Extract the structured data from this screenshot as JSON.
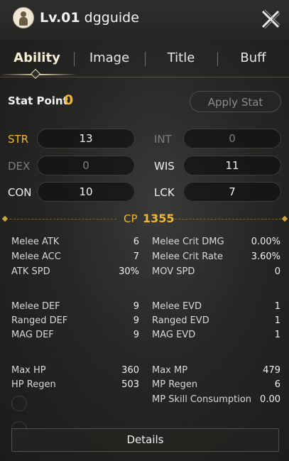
{
  "header": {
    "level": "Lv.01",
    "name": "dgguide"
  },
  "tabs": [
    {
      "label": "Ability",
      "active": true
    },
    {
      "label": "Image"
    },
    {
      "label": "Title"
    },
    {
      "label": "Buff"
    }
  ],
  "stat_point": {
    "label": "Stat Point",
    "value": "0",
    "apply_label": "Apply Stat"
  },
  "stats": {
    "str": {
      "label": "STR",
      "value": "13"
    },
    "int": {
      "label": "INT",
      "value": "0"
    },
    "dex": {
      "label": "DEX",
      "value": "0"
    },
    "wis": {
      "label": "WIS",
      "value": "11"
    },
    "con": {
      "label": "CON",
      "value": "10"
    },
    "lck": {
      "label": "LCK",
      "value": "7"
    }
  },
  "cp": {
    "label": "CP",
    "value": "1355"
  },
  "attributes": {
    "melee_atk": {
      "label": "Melee ATK",
      "value": "6"
    },
    "melee_crit_dmg": {
      "label": "Melee Crit DMG",
      "value": "0.00%"
    },
    "melee_acc": {
      "label": "Melee ACC",
      "value": "7"
    },
    "melee_crit_rate": {
      "label": "Melee Crit Rate",
      "value": "3.60%"
    },
    "atk_spd": {
      "label": "ATK SPD",
      "value": "30%"
    },
    "mov_spd": {
      "label": "MOV SPD",
      "value": "0"
    },
    "melee_def": {
      "label": "Melee DEF",
      "value": "9"
    },
    "melee_evd": {
      "label": "Melee EVD",
      "value": "1"
    },
    "ranged_def": {
      "label": "Ranged DEF",
      "value": "9"
    },
    "ranged_evd": {
      "label": "Ranged EVD",
      "value": "1"
    },
    "mag_def": {
      "label": "MAG DEF",
      "value": "9"
    },
    "mag_evd": {
      "label": "MAG EVD",
      "value": "1"
    },
    "max_hp": {
      "label": "Max HP",
      "value": "360"
    },
    "max_mp": {
      "label": "Max MP",
      "value": "479"
    },
    "hp_regen": {
      "label": "HP Regen",
      "value": "503"
    },
    "mp_regen": {
      "label": "MP Regen",
      "value": "6"
    },
    "mp_skill_consumption": {
      "label": "MP Skill Consumption",
      "value": "0.00"
    }
  },
  "details_label": "Details",
  "colors": {
    "accent_gold": "#f2b632",
    "highlight_str": "#f2b632"
  },
  "icons": {
    "avatar": "character-portrait-icon",
    "close": "close-x-icon"
  }
}
